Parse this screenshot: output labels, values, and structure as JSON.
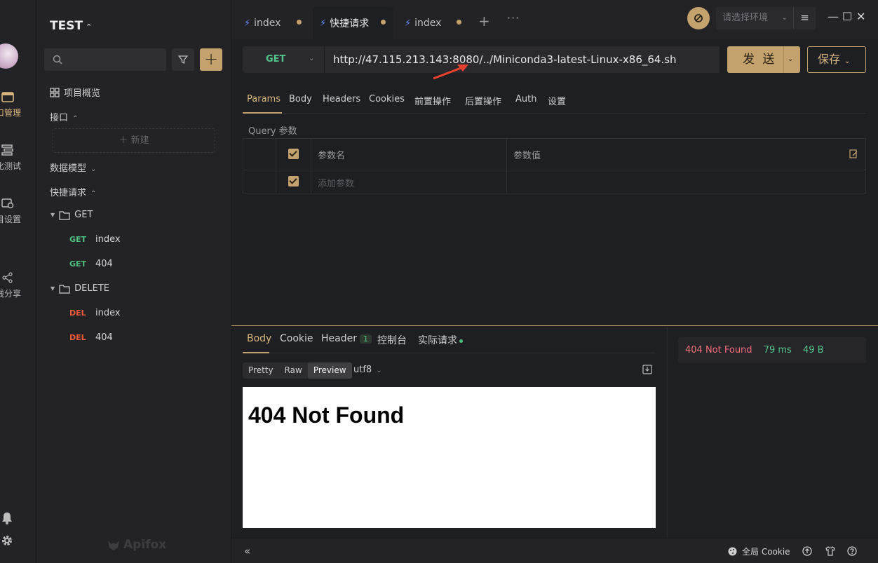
{
  "rail": {
    "items": [
      {
        "label": "口管理"
      },
      {
        "label": "化测试"
      },
      {
        "label": "目设置"
      },
      {
        "label": "线分享"
      }
    ]
  },
  "sidebar": {
    "project_name": "TEST",
    "overview_label": "项目概览",
    "api_section_label": "接口",
    "new_label": "新建",
    "models_label": "数据模型",
    "quick_label": "快捷请求",
    "folders": [
      {
        "name": "GET",
        "items": [
          {
            "method": "GET",
            "name": "index"
          },
          {
            "method": "GET",
            "name": "404"
          }
        ]
      },
      {
        "name": "DELETE",
        "items": [
          {
            "method": "DEL",
            "name": "index"
          },
          {
            "method": "DEL",
            "name": "404"
          }
        ]
      }
    ],
    "brand": "Apifox"
  },
  "tabs": [
    {
      "label": "index"
    },
    {
      "label": "快捷请求"
    },
    {
      "label": "index"
    }
  ],
  "env": {
    "placeholder": "请选择环境"
  },
  "request": {
    "method": "GET",
    "url": "http://47.115.213.143:8080/../Miniconda3-latest-Linux-x86_64.sh",
    "send_label": "发 送",
    "save_label": "保存",
    "tabs": [
      "Params",
      "Body",
      "Headers",
      "Cookies",
      "前置操作",
      "后置操作",
      "Auth",
      "设置"
    ],
    "query_label": "Query 参数",
    "col_name": "参数名",
    "col_value": "参数值",
    "add_param_placeholder": "添加参数"
  },
  "response": {
    "tabs": [
      "Body",
      "Cookie",
      "Header",
      "控制台",
      "实际请求"
    ],
    "header_count": "1",
    "view_modes": [
      "Pretty",
      "Raw",
      "Preview"
    ],
    "encoding": "utf8",
    "preview_heading": "404 Not Found",
    "status": "404 Not Found",
    "time": "79 ms",
    "size": "49 B"
  },
  "statusbar": {
    "cookie_label": "全局 Cookie"
  },
  "colors": {
    "accent": "#c4a26e",
    "get": "#4fbf7f",
    "delete": "#ee5a3a",
    "error": "#ef6f78"
  }
}
